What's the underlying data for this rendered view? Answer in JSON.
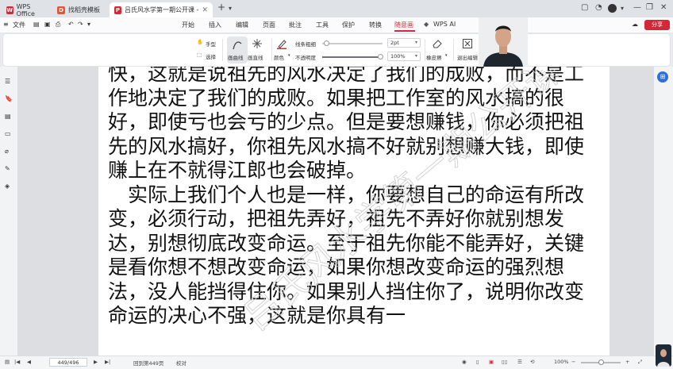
{
  "titlebar": {
    "tabs": [
      {
        "label": "WPS Office",
        "color": "#d4283a",
        "icon": "W"
      },
      {
        "label": "找稻壳模板",
        "color": "#e5533e",
        "icon": "D"
      },
      {
        "label": "吕氏风水学第一期公开课 - 原",
        "color": "#d4283a",
        "icon": "P"
      }
    ],
    "add_tab": "+",
    "tab_menu": "▾"
  },
  "menubar": {
    "file_label": "文件",
    "tabs": [
      "开始",
      "插入",
      "编辑",
      "页面",
      "批注",
      "工具",
      "保护",
      "转换",
      "随意画"
    ],
    "active_tab": "随意画",
    "wps_ai_label": "WPS AI",
    "share_label": "分享"
  },
  "ribbon": {
    "hand_label": "手型",
    "select_label": "选择",
    "pen_label": "画曲线",
    "eraser_label": "画直线",
    "color_label": "颜色",
    "line_width_label": "线条粗细",
    "opacity_label": "不透明度",
    "line_width_value": "2pt",
    "opacity_value": "100%",
    "eraser_tool_label": "橡皮擦",
    "exit_label": "退出编辑",
    "accent_color": "#d4283a"
  },
  "document": {
    "paragraphs": [
      "快，这就是说祖先的风水决定了我们的成败，而不是工作地决定了我们的成败。如果把工作室的风水搞的很好，即使亏也会亏的少点。但是要想赚钱，你必须把祖先的风水搞好，你祖先风水搞不好就别想赚大钱，即使赚上在不就得江郎也会破掉。",
      "实际上我们个人也是一样，你要想自己的命运有所改变，必须行动，把祖先弄好，祖先不弄好你就别想发达，别想彻底改变命运。至于祖先你能不能弄好，关键是看你想不想改变命运，如果你想改变命运的强烈想法，没人能挡得住你。如果别人挡住你了，说明你改变命运的决心不强，这就是你具有一"
    ],
    "watermark_text": "吕氏风水学第一期公开课"
  },
  "statusbar": {
    "page_value": "449/496",
    "return_label": "回到第449页",
    "proofread_label": "校对",
    "zoom_value": "100%"
  }
}
